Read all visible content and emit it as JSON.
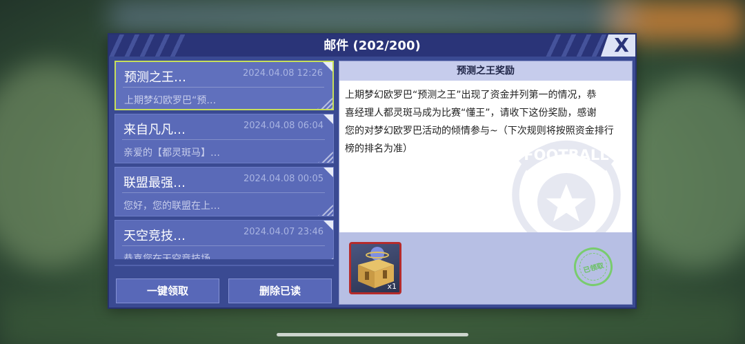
{
  "dialog": {
    "title": "邮件 (202/200)",
    "close_label": "X"
  },
  "mails": [
    {
      "title": "预测之王…",
      "date": "2024.04.08 12:26",
      "preview": "上期梦幻欧罗巴“预…",
      "selected": true
    },
    {
      "title": "来自凡凡…",
      "date": "2024.04.08 06:04",
      "preview": "亲爱的【都灵斑马】…",
      "selected": false
    },
    {
      "title": "联盟最强…",
      "date": "2024.04.08 00:05",
      "preview": "您好，您的联盟在上…",
      "selected": false
    },
    {
      "title": "天空竞技…",
      "date": "2024.04.07 23:46",
      "preview": "恭喜您在天空竞技场…",
      "selected": false
    }
  ],
  "actions": {
    "claim_all": "一键领取",
    "delete_read": "删除已读"
  },
  "detail": {
    "header": "预测之王奖励",
    "body": "上期梦幻欧罗巴“预测之王”出现了资金并列第一的情况，恭\n喜经理人都灵斑马成为比赛“懂王”，请收下这份奖励，感谢\n您的对梦幻欧罗巴活动的倾情参与~（下次规则将按照资金排行\n榜的排名为准）",
    "reward": {
      "icon": "treasure-chest-icon",
      "quantity": "x1"
    },
    "stamp": "已领取",
    "watermark_text": "FOOTBALL"
  },
  "colors": {
    "selected_border": "#c8e05a",
    "reward_border": "#b52b2b",
    "stamp": "#6fcf5a"
  }
}
